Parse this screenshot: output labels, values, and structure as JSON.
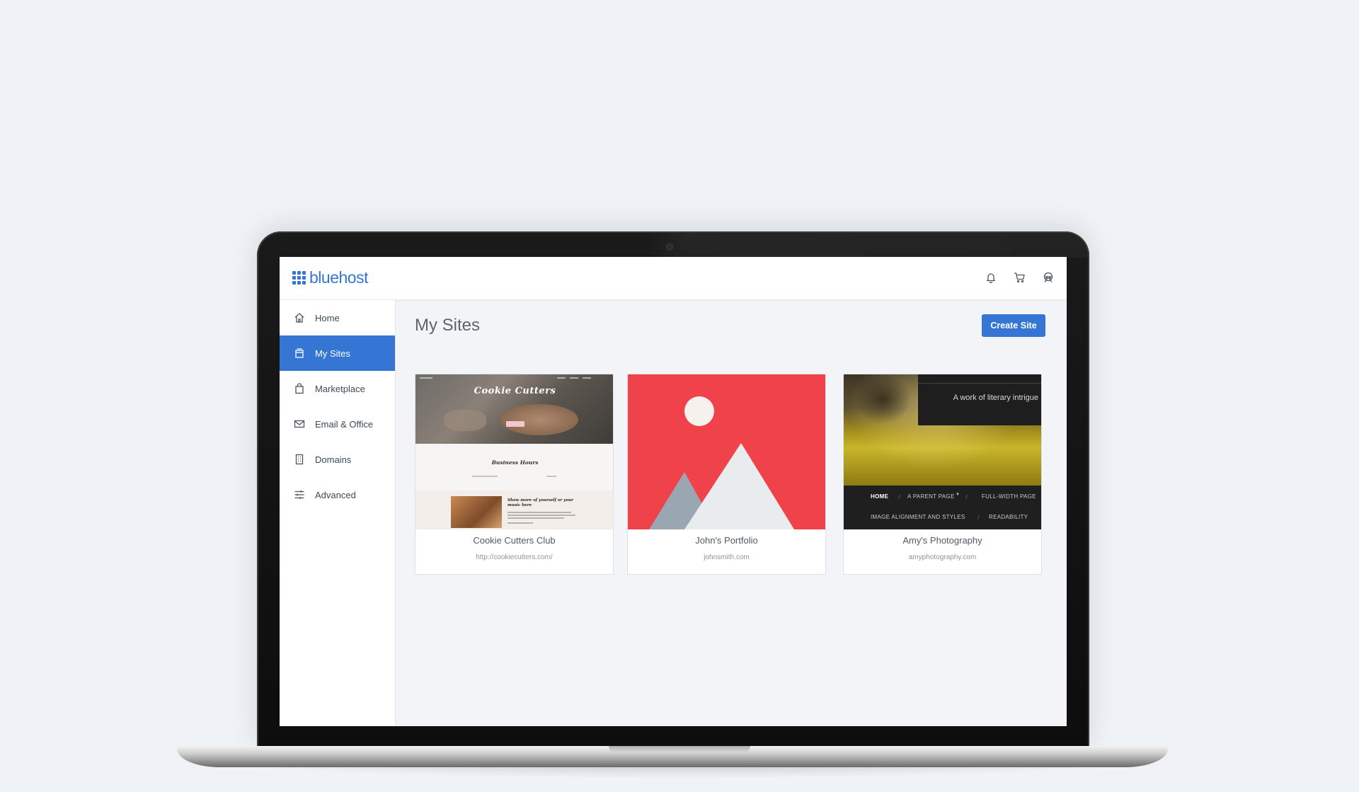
{
  "app": {
    "brand": "bluehost",
    "accent_color": "#3575d3"
  },
  "topbar": {
    "icons": [
      "bell-icon",
      "cart-icon",
      "account-icon"
    ]
  },
  "sidebar": {
    "items": [
      {
        "label": "Home",
        "icon": "home-icon",
        "active": false
      },
      {
        "label": "My Sites",
        "icon": "sites-icon",
        "active": true
      },
      {
        "label": "Marketplace",
        "icon": "shopping-bag-icon",
        "active": false
      },
      {
        "label": "Email & Office",
        "icon": "envelope-icon",
        "active": false
      },
      {
        "label": "Domains",
        "icon": "building-icon",
        "active": false
      },
      {
        "label": "Advanced",
        "icon": "sliders-icon",
        "active": false
      }
    ]
  },
  "main": {
    "title": "My Sites",
    "create_button": "Create Site"
  },
  "sites": [
    {
      "name": "Cookie Cutters Club",
      "url": "http://cookiecutters.com/",
      "thumb": {
        "title": "Cookie Cutters",
        "section": "Business Hours",
        "promo": "Show more of yourself or your music here"
      }
    },
    {
      "name": "John's Portfolio",
      "url": "johnsmith.com",
      "thumb": {
        "color": "#f0424a"
      }
    },
    {
      "name": "Amy's Photography",
      "url": "amyphotography.com",
      "thumb": {
        "tagline": "A work of literary intrigue",
        "nav": [
          "HOME",
          "A PARENT PAGE",
          "FULL-WIDTH PAGE",
          "IMAGE ALIGNMENT AND STYLES",
          "READABILITY"
        ]
      }
    }
  ]
}
